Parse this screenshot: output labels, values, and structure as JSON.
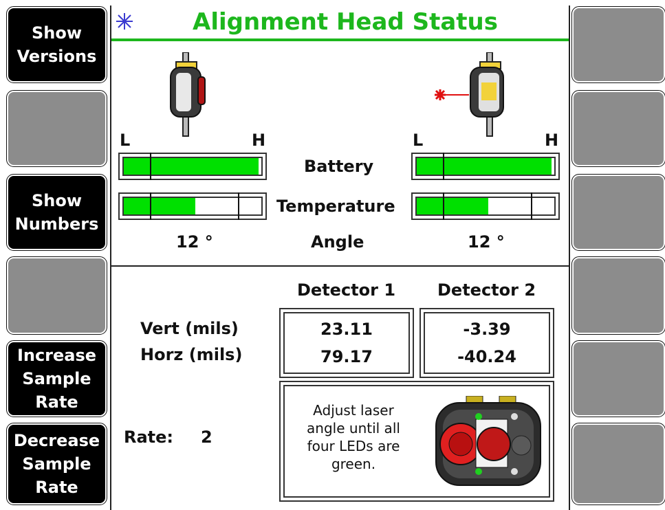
{
  "softkeys": {
    "left": [
      "Show\nVersions",
      "",
      "Show\nNumbers",
      "",
      "Increase\nSample\nRate",
      "Decrease\nSample\nRate"
    ],
    "right": [
      "",
      "",
      "",
      "",
      "",
      ""
    ]
  },
  "header": {
    "title": "Alignment Head Status",
    "icon": "laser-star-icon"
  },
  "gauges": {
    "low_label": "L",
    "high_label": "H",
    "battery_label": "Battery",
    "temperature_label": "Temperature",
    "angle_label": "Angle",
    "left": {
      "battery_level": 0.98,
      "temperature_level": 0.52,
      "angle": "12 °"
    },
    "right": {
      "battery_level": 0.98,
      "temperature_level": 0.52,
      "angle": "12 °"
    }
  },
  "readings": {
    "columns": [
      "Detector 1",
      "Detector 2"
    ],
    "row_labels": [
      "Vert (mils)",
      "Horz (mils)"
    ],
    "detector1": {
      "vert": "23.11",
      "horz": "79.17"
    },
    "detector2": {
      "vert": "-3.39",
      "horz": "-40.24"
    }
  },
  "rate": {
    "label": "Rate:",
    "value": "2"
  },
  "instruction": "Adjust laser angle until all four LEDs are green.",
  "colors": {
    "accent": "#1db71d",
    "fill": "#00e000",
    "laser": "#e01010",
    "softkey_active": "#000000",
    "softkey_blank": "#8c8c8c"
  }
}
